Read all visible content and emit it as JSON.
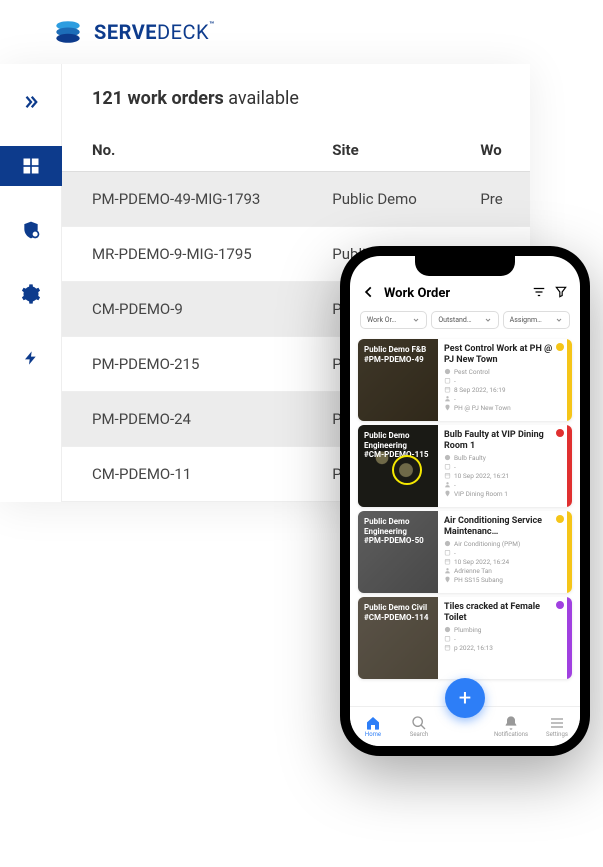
{
  "logo": {
    "serve": "SERVE",
    "deck": "DECK",
    "tm": "™"
  },
  "summary": {
    "count": "121 work orders",
    "suffix": " available"
  },
  "columns": {
    "no": "No.",
    "site": "Site",
    "wo": "Wo"
  },
  "rows": [
    {
      "no": "PM-PDEMO-49-MIG-1793",
      "site": "Public Demo",
      "wo": "Pre",
      "sel": true
    },
    {
      "no": "MR-PDEMO-9-MIG-1795",
      "site": "Public D",
      "wo": "",
      "sel": false
    },
    {
      "no": "CM-PDEMO-9",
      "site": "Public D",
      "wo": "",
      "sel": true
    },
    {
      "no": "PM-PDEMO-215",
      "site": "Public D",
      "wo": "",
      "sel": false
    },
    {
      "no": "PM-PDEMO-24",
      "site": "Public D",
      "wo": "",
      "sel": true
    },
    {
      "no": "CM-PDEMO-11",
      "site": "Public D",
      "wo": "",
      "sel": false
    }
  ],
  "phone": {
    "title": "Work Order",
    "filters": [
      {
        "label": "Work Or…"
      },
      {
        "label": "Outstand…"
      },
      {
        "label": "Assignm…"
      }
    ],
    "cards": [
      {
        "overlay1": "Public Demo F&B",
        "overlay2": "#PM-PDEMO-49",
        "title": "Pest Control Work at PH @ PJ New Town",
        "type": "Pest Control",
        "date": "8 Sep 2022, 16:19",
        "assignee": "-",
        "location": "PH @ PJ New Town",
        "stripe": "#f5c518",
        "dot": "#f5c518",
        "img": "img-pest"
      },
      {
        "overlay1": "Public Demo Engineering",
        "overlay2": "#CM-PDEMO-115",
        "title": "Bulb Faulty at VIP Dining Room 1",
        "type": "Bulb Faulty",
        "date": "10 Sep 2022, 16:21",
        "assignee": "-",
        "location": "VIP Dining Room 1",
        "stripe": "#e03030",
        "dot": "#e03030",
        "img": "img-bulb"
      },
      {
        "overlay1": "Public Demo Engineering",
        "overlay2": "#PM-PDEMO-50",
        "title": "Air Conditioning Service Maintenanc…",
        "type": "Air Conditioning (PPM)",
        "date": "10 Sep 2022, 16:24",
        "assignee": "Adrienne Tan",
        "location": "PH SS15 Subang",
        "stripe": "#f5c518",
        "dot": "#f5c518",
        "img": "img-ac"
      },
      {
        "overlay1": "Public Demo Civil",
        "overlay2": "#CM-PDEMO-114",
        "title": "Tiles cracked at Female Toilet",
        "type": "Plumbing",
        "date": "p 2022, 16:13",
        "assignee": "",
        "location": "",
        "stripe": "#a040e0",
        "dot": "#a040e0",
        "img": "img-tile"
      }
    ],
    "tabs": [
      {
        "label": "Home",
        "active": true
      },
      {
        "label": "Search",
        "active": false
      },
      {
        "label": "",
        "active": false
      },
      {
        "label": "Notifications",
        "active": false
      },
      {
        "label": "Settings",
        "active": false
      }
    ]
  }
}
